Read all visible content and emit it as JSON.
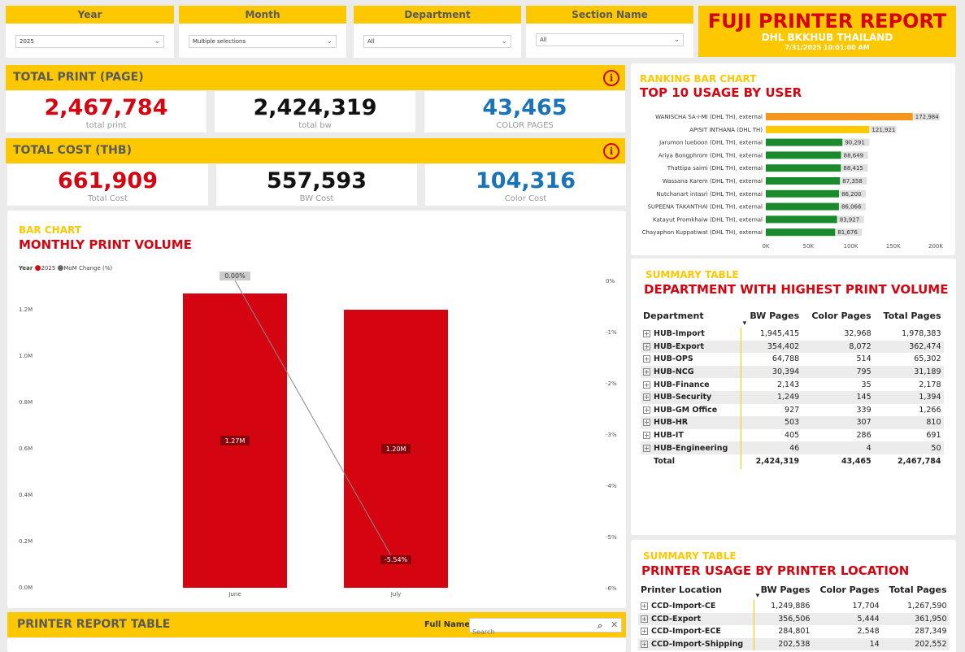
{
  "slicers": [
    {
      "title": "Year",
      "value": "2025"
    },
    {
      "title": "Month",
      "value": "Multiple selections"
    },
    {
      "title": "Department",
      "value": "All"
    },
    {
      "title": "Section Name",
      "value": "All"
    }
  ],
  "report": {
    "title": "FUJI PRINTER REPORT",
    "subtitle": "DHL BKKHUB THAILAND",
    "date": "7/31/2025 10:01:00 AM"
  },
  "total_print": {
    "header": "TOTAL PRINT (PAGE)",
    "cards": [
      {
        "value": "2,467,784",
        "label": "total print",
        "color": "#d40511"
      },
      {
        "value": "2,424,319",
        "label": "total bw",
        "color": "#111111"
      },
      {
        "value": "43,465",
        "label": "COLOR PAGES",
        "color": "#1a73b8"
      }
    ]
  },
  "total_cost": {
    "header": "TOTAL COST (THB)",
    "cards": [
      {
        "value": "661,909",
        "label": "Total Cost",
        "color": "#d40511"
      },
      {
        "value": "557,593",
        "label": "BW Cost",
        "color": "#111111"
      },
      {
        "value": "104,316",
        "label": "Color Cost",
        "color": "#1a73b8"
      }
    ]
  },
  "monthly": {
    "kicker": "BAR CHART",
    "title": "MONTHLY PRINT VOLUME",
    "legend_title": "Year",
    "legend_items": [
      "2025",
      "MoM Change (%)"
    ]
  },
  "chart_data": [
    {
      "type": "bar",
      "title": "MONTHLY PRINT VOLUME",
      "categories": [
        "June",
        "July"
      ],
      "series": [
        {
          "name": "2025",
          "values": [
            1270000,
            1200000
          ],
          "labels": [
            "1.27M",
            "1.20M"
          ],
          "color": "#d40511"
        },
        {
          "name": "MoM Change (%)",
          "type": "line",
          "values": [
            0.0,
            -5.54
          ],
          "labels": [
            "0.00%",
            "-5.54%"
          ],
          "color": "#888888"
        }
      ],
      "y_left": {
        "ticks": [
          "0.0M",
          "0.2M",
          "0.4M",
          "0.6M",
          "0.8M",
          "1.0M",
          "1.2M"
        ],
        "lim": [
          0,
          1270000
        ]
      },
      "y_right": {
        "ticks": [
          "0%",
          "-1%",
          "-2%",
          "-3%",
          "-4%",
          "-5%",
          "-6%"
        ],
        "lim": [
          -6,
          0
        ]
      }
    },
    {
      "type": "bar",
      "title": "TOP 10 USAGE BY USER",
      "orientation": "horizontal",
      "categories": [
        "WANISCHA SA-I-MI (DHL TH), external",
        "APISIT INTHANA (DHL TH)",
        "Jarumon lueboon (DHL TH), external",
        "Ariya Bongphrom (DHL TH), external",
        "Thattipa saimi (DHL TH), external",
        "Wassana Karem (DHL TH), external",
        "Nutchanart intasri (DHL TH), external",
        "SUPEENA TAKANTHAI (DHL TH), external",
        "Katayut Promkhaiw (DHL TH), external",
        "Chayaphon Kuppatiwat (DHL TH), external"
      ],
      "values": [
        172984,
        121921,
        90291,
        88649,
        88415,
        87358,
        86200,
        86066,
        83927,
        81676
      ],
      "labels": [
        "172,984",
        "121,921",
        "90,291",
        "88,649",
        "88,415",
        "87,358",
        "86,200",
        "86,066",
        "83,927",
        "81,676"
      ],
      "colors": [
        "#f7941d",
        "#fdc800",
        "#1a8a2c",
        "#1a8a2c",
        "#1a8a2c",
        "#1a8a2c",
        "#1a8a2c",
        "#1a8a2c",
        "#1a8a2c",
        "#1a8a2c"
      ],
      "x_ticks": [
        "0K",
        "50K",
        "100K",
        "150K",
        "200K"
      ],
      "xlim": [
        0,
        200000
      ]
    }
  ],
  "ranking": {
    "kicker": "RANKING BAR CHART",
    "title": "TOP 10 USAGE BY USER"
  },
  "dept": {
    "kicker": "SUMMARY TABLE",
    "title": "DEPARTMENT WITH HIGHEST PRINT VOLUME",
    "columns": [
      "Department",
      "BW Pages",
      "Color Pages",
      "Total Pages"
    ],
    "rows": [
      [
        "HUB-Import",
        "1,945,415",
        "32,968",
        "1,978,383"
      ],
      [
        "HUB-Export",
        "354,402",
        "8,072",
        "362,474"
      ],
      [
        "HUB-OPS",
        "64,788",
        "514",
        "65,302"
      ],
      [
        "HUB-NCG",
        "30,394",
        "795",
        "31,189"
      ],
      [
        "HUB-Finance",
        "2,143",
        "35",
        "2,178"
      ],
      [
        "HUB-Security",
        "1,249",
        "145",
        "1,394"
      ],
      [
        "HUB-GM Office",
        "927",
        "339",
        "1,266"
      ],
      [
        "HUB-HR",
        "503",
        "307",
        "810"
      ],
      [
        "HUB-IT",
        "405",
        "286",
        "691"
      ],
      [
        "HUB-Engineering",
        "46",
        "4",
        "50"
      ]
    ],
    "total": [
      "Total",
      "2,424,319",
      "43,465",
      "2,467,784"
    ]
  },
  "location": {
    "kicker": "SUMMARY TABLE",
    "title": "PRINTER USAGE BY PRINTER LOCATION",
    "columns": [
      "Printer Location",
      "BW Pages",
      "Color Pages",
      "Total Pages"
    ],
    "rows": [
      [
        "CCD-Import-CE",
        "1,249,886",
        "17,704",
        "1,267,590"
      ],
      [
        "CCD-Export",
        "356,506",
        "5,444",
        "361,950"
      ],
      [
        "CCD-Import-ECE",
        "284,801",
        "2,548",
        "287,349"
      ],
      [
        "CCD-Import-Shipping",
        "202,538",
        "14",
        "202,552"
      ]
    ]
  },
  "report_table": {
    "header": "PRINTER REPORT TABLE",
    "filter_label": "Full Name:",
    "search_placeholder": "Search"
  }
}
